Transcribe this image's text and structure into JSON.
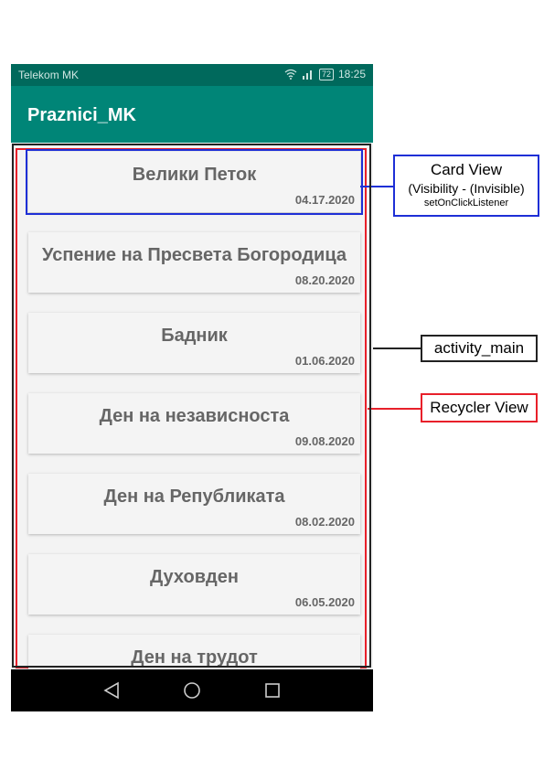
{
  "status_bar": {
    "carrier": "Telekom MK",
    "battery": "72",
    "time": "18:25"
  },
  "toolbar": {
    "title": "Praznici_MK"
  },
  "holidays": [
    {
      "name": "Велики Петок",
      "date": "04.17.2020"
    },
    {
      "name": "Успение на Пресвета Богородица",
      "date": "08.20.2020"
    },
    {
      "name": "Бадник",
      "date": "01.06.2020"
    },
    {
      "name": "Ден на независноста",
      "date": "09.08.2020"
    },
    {
      "name": "Ден на Републиката",
      "date": "08.02.2020"
    },
    {
      "name": "Духовден",
      "date": "06.05.2020"
    },
    {
      "name": "Ден на трудот",
      "date": ""
    }
  ],
  "annotations": {
    "card_view": {
      "title": "Card View",
      "subtitle": "(Visibility - (Invisible)",
      "detail": "setOnClickListener"
    },
    "activity_main": "activity_main",
    "recycler_view": "Recycler View"
  },
  "colors": {
    "toolbar": "#008577",
    "status_bar": "#00695c",
    "card_outline": "#1e2fd6",
    "recycler_outline": "#e8202a",
    "activity_outline": "#222222"
  },
  "icons": [
    "wifi-icon",
    "signal-icon",
    "battery-icon",
    "back-icon",
    "home-icon",
    "recents-icon"
  ]
}
